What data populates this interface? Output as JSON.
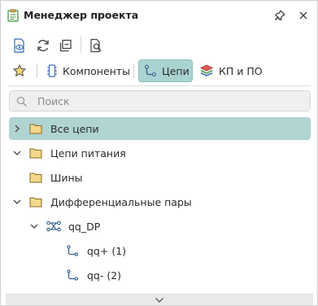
{
  "window": {
    "title": "Менеджер проекта",
    "title_icon": "project-manager-icon",
    "pin_icon": "pin-icon",
    "close_icon": "close-icon"
  },
  "toolbar": {
    "buttons": [
      {
        "name": "open-doc-button",
        "icon": "document-eye-icon"
      },
      {
        "name": "refresh-button",
        "icon": "refresh-icon"
      },
      {
        "name": "collapse-all-button",
        "icon": "collapse-icon"
      },
      {
        "name": "find-in-doc-button",
        "icon": "doc-search-icon"
      }
    ]
  },
  "tabs": [
    {
      "id": "favorites",
      "label": "",
      "icon": "star-icon",
      "active": false
    },
    {
      "id": "components",
      "label": "Компоненты",
      "icon": "chip-icon",
      "active": false
    },
    {
      "id": "nets",
      "label": "Цепи",
      "icon": "net-icon",
      "active": true
    },
    {
      "id": "layers",
      "label": "КП и ПО",
      "icon": "layers-icon",
      "active": false
    }
  ],
  "search": {
    "placeholder": "Поиск",
    "value": ""
  },
  "tree": [
    {
      "label": "Все цепи",
      "level": 0,
      "expanded": false,
      "selected": true,
      "icon": "folder-icon"
    },
    {
      "label": "Цепи питания",
      "level": 0,
      "expanded": true,
      "selected": false,
      "icon": "folder-icon"
    },
    {
      "label": "Шины",
      "level": 0,
      "expanded": null,
      "selected": false,
      "icon": "folder-icon"
    },
    {
      "label": "Дифференциальные пары",
      "level": 0,
      "expanded": true,
      "selected": false,
      "icon": "folder-icon"
    },
    {
      "label": "qq_DP",
      "level": 1,
      "expanded": true,
      "selected": false,
      "icon": "diff-pair-icon"
    },
    {
      "label": "qq+ (1)",
      "level": 2,
      "expanded": null,
      "selected": false,
      "icon": "net-icon"
    },
    {
      "label": "qq- (2)",
      "level": 2,
      "expanded": null,
      "selected": false,
      "icon": "net-icon"
    }
  ],
  "colors": {
    "accent": "#a9d3d1",
    "selected_row": "#afd4d2",
    "folder": "#e8c777",
    "net_icon": "#3a8fd0"
  }
}
